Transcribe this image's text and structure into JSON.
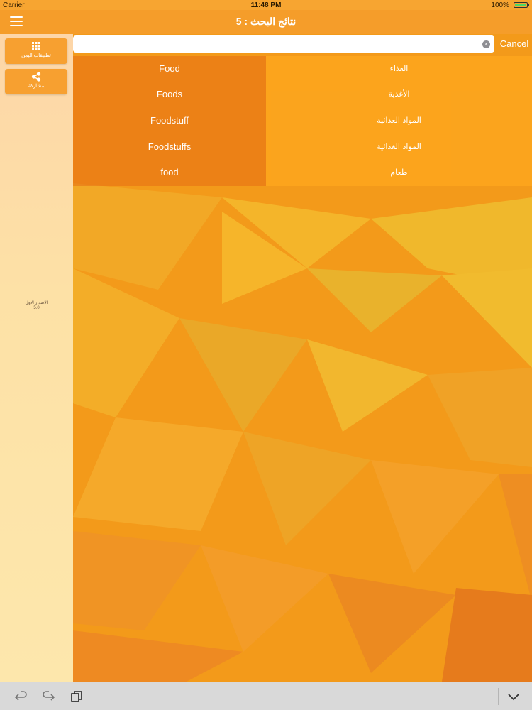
{
  "status_bar": {
    "carrier": "Carrier",
    "time": "11:48 PM",
    "battery": "100%"
  },
  "nav": {
    "title": "نتائج البحث : 5"
  },
  "search": {
    "value": "",
    "placeholder": "",
    "cancel_label": "Cancel"
  },
  "sidebar": {
    "buttons": [
      {
        "label": "تطبيقات اليمن",
        "icon": "grid-icon"
      },
      {
        "label": "مشاركة",
        "icon": "share-icon"
      }
    ],
    "version_label": "الاصدار الاول",
    "version_number": "5.0"
  },
  "results": [
    {
      "english": "Food",
      "arabic": "الغذاء"
    },
    {
      "english": "Foods",
      "arabic": "الأغذية"
    },
    {
      "english": "Foodstuff",
      "arabic": "المواد الغذائية"
    },
    {
      "english": "Foodstuffs",
      "arabic": "المواد الغذائية"
    },
    {
      "english": "food",
      "arabic": "طعام"
    }
  ],
  "colors": {
    "accent": "#f59d2a",
    "background": "#f39a1a"
  }
}
